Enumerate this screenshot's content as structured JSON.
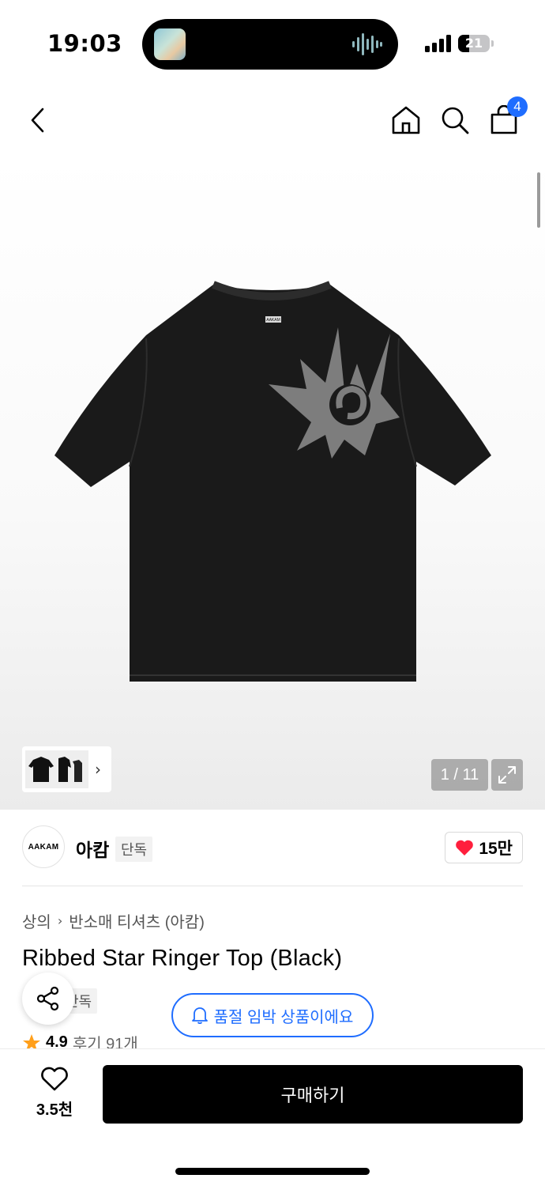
{
  "status_bar": {
    "time": "19:03",
    "battery": "21"
  },
  "header": {
    "cart_count": "4"
  },
  "gallery": {
    "counter": "1 / 11"
  },
  "brand": {
    "logo_text": "AAKAM",
    "name": "아캄",
    "tag": "단독",
    "likes": "15만"
  },
  "breadcrumb": {
    "category": "상의",
    "subcategory": "반소매 티셔츠 (아캄)"
  },
  "product": {
    "title": "Ribbed Star Ringer Top (Black)",
    "tag": "단독",
    "tshirt_label": "AAKAM"
  },
  "stock_alert": "품절 임박 상품이에요",
  "rating": {
    "score": "4.9",
    "reviews": "후기 91개"
  },
  "bottom": {
    "wish_count": "3.5천",
    "buy_label": "구매하기"
  },
  "colors": {
    "accent": "#1f6dff",
    "like": "#ff1f3d",
    "star": "#ff9f1a"
  }
}
